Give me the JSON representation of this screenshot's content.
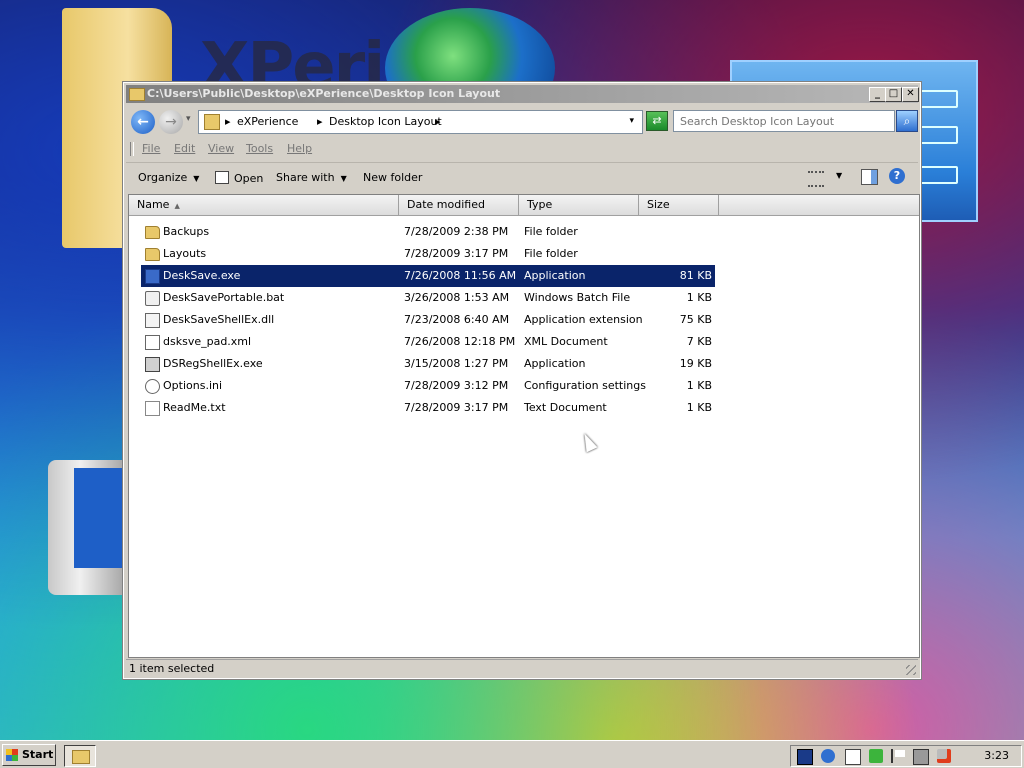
{
  "window": {
    "title": "C:\\Users\\Public\\Desktop\\eXPerience\\Desktop Icon Layout",
    "buttons": {
      "minimize": "_",
      "maximize": "□",
      "close": "✕"
    }
  },
  "address": {
    "crumbs": [
      "eXPerience",
      "Desktop Icon Layout"
    ],
    "sep": "▸",
    "dropdown": "▾"
  },
  "search": {
    "placeholder": "Search Desktop Icon Layout"
  },
  "menu": [
    "File",
    "Edit",
    "View",
    "Tools",
    "Help"
  ],
  "toolbar": {
    "organize": "Organize",
    "open": "Open",
    "share_with": "Share with",
    "new_folder": "New folder",
    "arrow": "▼",
    "help": "?"
  },
  "columns": {
    "name": "Name",
    "date_modified": "Date modified",
    "type": "Type",
    "size": "Size",
    "sort": "▲"
  },
  "files": [
    {
      "name": "Backups",
      "date": "7/28/2009 2:38 PM",
      "type": "File folder",
      "size": "",
      "icon": "folder-icon"
    },
    {
      "name": "Layouts",
      "date": "7/28/2009 3:17 PM",
      "type": "File folder",
      "size": "",
      "icon": "folder-icon"
    },
    {
      "name": "DeskSave.exe",
      "date": "7/26/2008 11:56 AM",
      "type": "Application",
      "size": "81 KB",
      "icon": "application-icon",
      "selected": true
    },
    {
      "name": "DeskSavePortable.bat",
      "date": "3/26/2008 1:53 AM",
      "type": "Windows Batch File",
      "size": "1 KB",
      "icon": "batch-file-icon"
    },
    {
      "name": "DeskSaveShellEx.dll",
      "date": "7/23/2008 6:40 AM",
      "type": "Application extension",
      "size": "75 KB",
      "icon": "dll-icon"
    },
    {
      "name": "dsksve_pad.xml",
      "date": "7/26/2008 12:18 PM",
      "type": "XML Document",
      "size": "7 KB",
      "icon": "xml-icon"
    },
    {
      "name": "DSRegShellEx.exe",
      "date": "3/15/2008 1:27 PM",
      "type": "Application",
      "size": "19 KB",
      "icon": "application-icon"
    },
    {
      "name": "Options.ini",
      "date": "7/28/2009 3:12 PM",
      "type": "Configuration settings",
      "size": "1 KB",
      "icon": "settings-file-icon"
    },
    {
      "name": "ReadMe.txt",
      "date": "7/28/2009 3:17 PM",
      "type": "Text Document",
      "size": "1 KB",
      "icon": "text-file-icon"
    }
  ],
  "status": {
    "text": "1 item selected"
  },
  "desktop": {
    "logo_text": "XPerience"
  },
  "taskbar": {
    "start": "Start",
    "clock": "3:23",
    "tray_icons": [
      "network-icon",
      "media-icon",
      "document-icon",
      "security-icon",
      "flag-icon",
      "device-icon",
      "volume-muted-icon"
    ]
  },
  "colors": {
    "selection": "#0a246a",
    "titlebar_start": "#808080",
    "titlebar_end": "#b8b8b8"
  }
}
